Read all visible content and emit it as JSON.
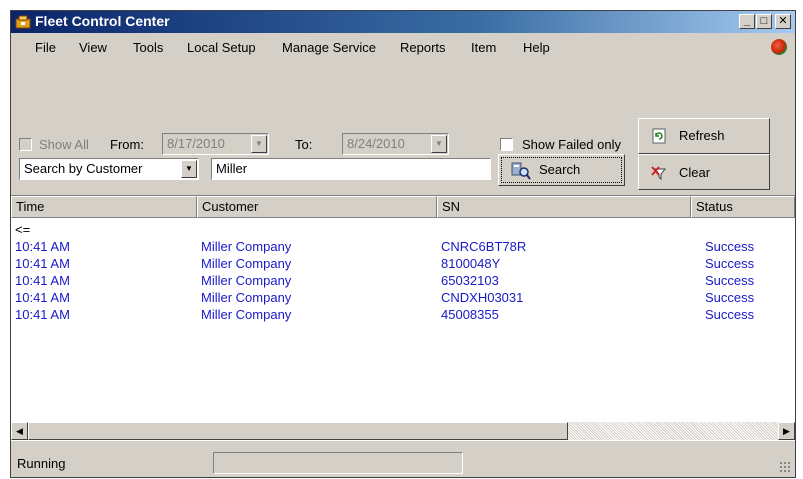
{
  "window": {
    "title": "Fleet Control Center"
  },
  "menu": {
    "items": [
      "File",
      "View",
      "Tools",
      "Local Setup",
      "Manage Service",
      "Reports",
      "Item",
      "Help"
    ]
  },
  "filters": {
    "show_all_label": "Show All",
    "from_label": "From:",
    "from_value": "8/17/2010",
    "to_label": "To:",
    "to_value": "8/24/2010",
    "show_failed_label": "Show Failed only"
  },
  "search": {
    "mode": "Search by Customer",
    "query": "Miller",
    "search_label": "Search",
    "refresh_label": "Refresh",
    "clear_label": "Clear"
  },
  "table": {
    "columns": [
      "Time",
      "Customer",
      "SN",
      "Status"
    ],
    "back_row": "<=",
    "rows": [
      {
        "time": "10:41 AM",
        "customer": "Miller Company",
        "sn": "CNRC6BT78R",
        "status": "Success"
      },
      {
        "time": "10:41 AM",
        "customer": "Miller Company",
        "sn": "8100048Y",
        "status": "Success"
      },
      {
        "time": "10:41 AM",
        "customer": "Miller Company",
        "sn": "65032103",
        "status": "Success"
      },
      {
        "time": "10:41 AM",
        "customer": "Miller Company",
        "sn": "CNDXH03031",
        "status": "Success"
      },
      {
        "time": "10:41 AM",
        "customer": "Miller Company",
        "sn": "45008355",
        "status": "Success"
      }
    ]
  },
  "status": {
    "text": "Running"
  },
  "colors": {
    "row_text": "#1a1ac8",
    "titlebar": "#0a246a"
  },
  "icons": [
    "app-icon",
    "minimize-icon",
    "maximize-icon",
    "close-icon",
    "status-globe-icon",
    "refresh-icon",
    "search-icon",
    "clear-filter-icon",
    "dropdown-arrow-icon",
    "scroll-left-icon",
    "scroll-right-icon",
    "resize-grip-icon"
  ]
}
